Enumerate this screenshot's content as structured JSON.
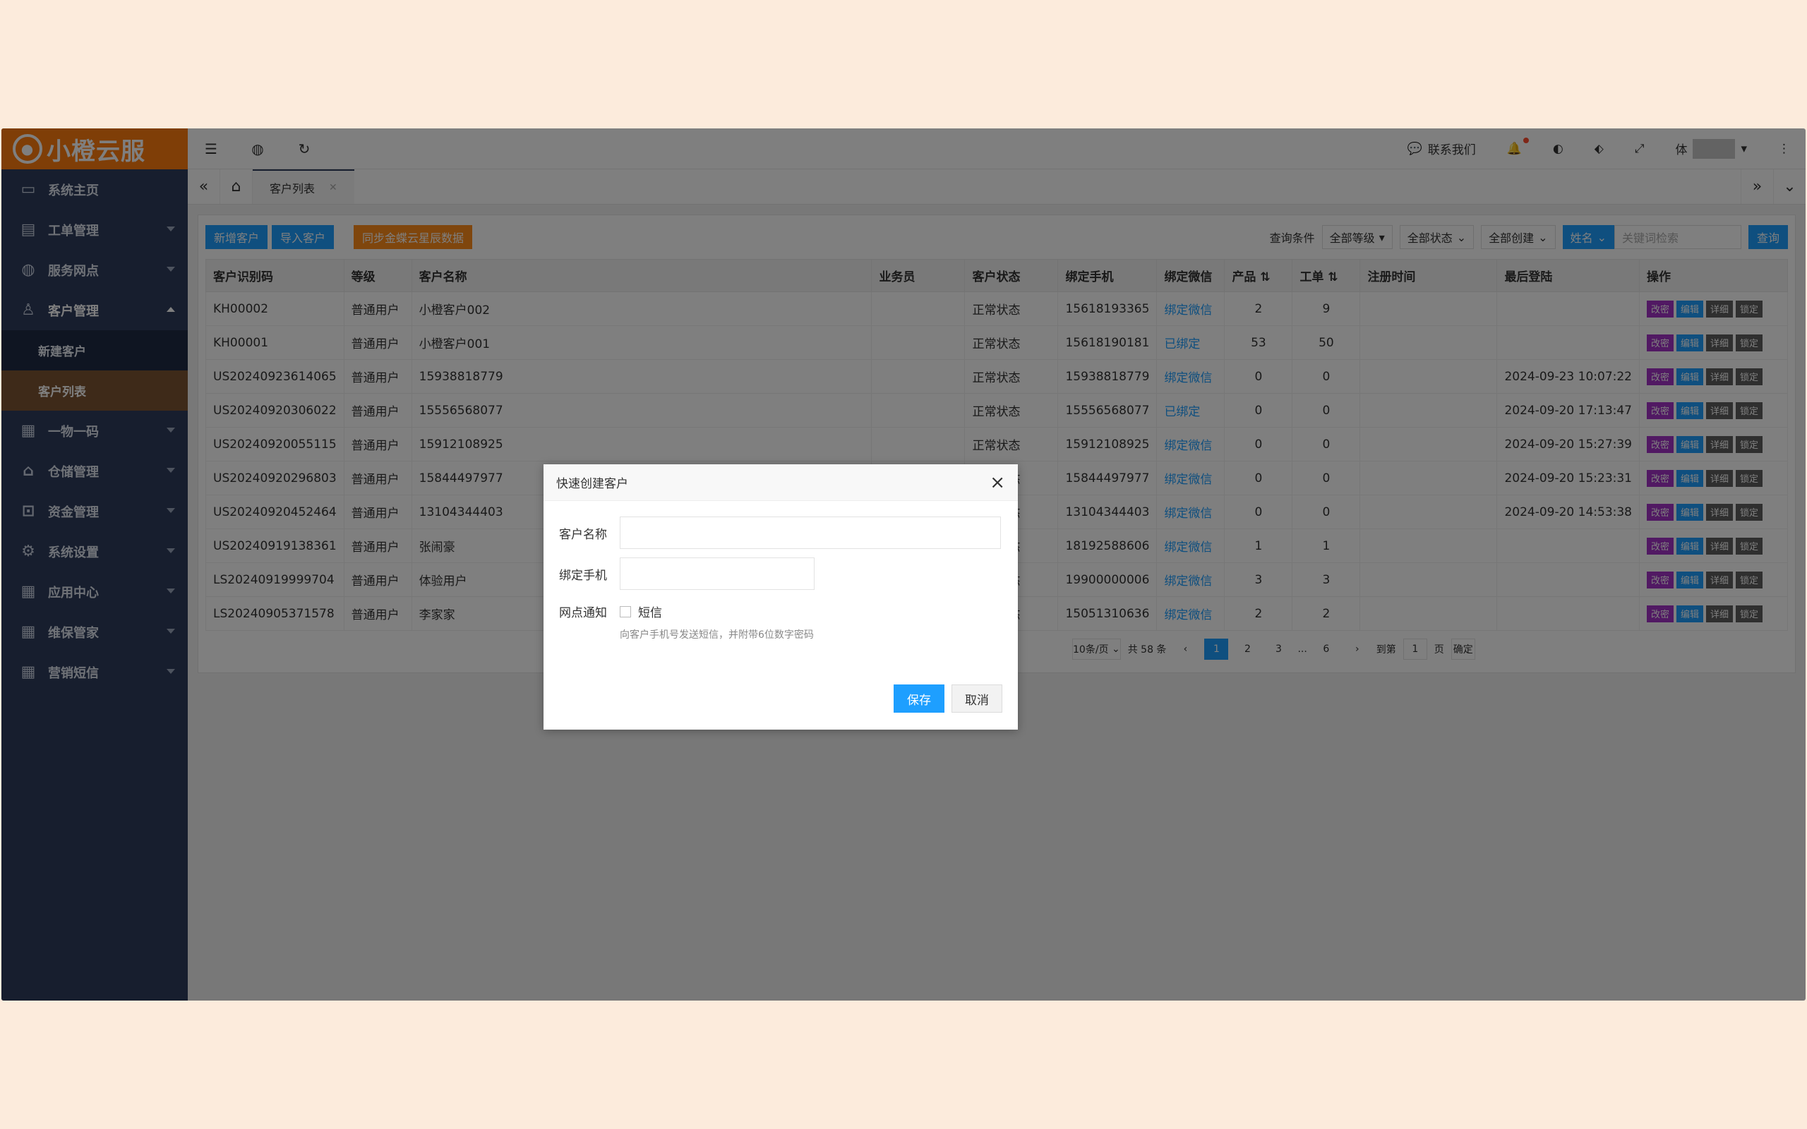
{
  "brand": {
    "logo_text": "小橙云服"
  },
  "sidebar": {
    "items": [
      {
        "label": "系统主页",
        "icon": "monitor-icon"
      },
      {
        "label": "工单管理",
        "icon": "document-icon"
      },
      {
        "label": "服务网点",
        "icon": "globe-icon"
      },
      {
        "label": "客户管理",
        "icon": "user-icon"
      },
      {
        "label": "一物一码",
        "icon": "grid-icon"
      },
      {
        "label": "仓储管理",
        "icon": "bank-icon"
      },
      {
        "label": "资金管理",
        "icon": "money-icon"
      },
      {
        "label": "系统设置",
        "icon": "gear-icon"
      },
      {
        "label": "应用中心",
        "icon": "grid-icon"
      },
      {
        "label": "维保管家",
        "icon": "grid-icon"
      },
      {
        "label": "营销短信",
        "icon": "grid-icon"
      }
    ],
    "sub_items": [
      "新建客户",
      "客户列表"
    ]
  },
  "topbar": {
    "contact_label": "联系我们",
    "user_label": "体"
  },
  "tabs": {
    "active_tab": "客户列表"
  },
  "toolbar": {
    "new_customer": "新增客户",
    "import_customer": "导入客户",
    "sync": "同步金蝶云星辰数据",
    "query_label": "查询条件",
    "filter_level": "全部等级",
    "filter_status": "全部状态",
    "filter_created": "全部创建",
    "filter_field": "姓名",
    "keyword_placeholder": "关键词检索",
    "search": "查询"
  },
  "table": {
    "headers": [
      "客户识别码",
      "等级",
      "客户名称",
      "业务员",
      "客户状态",
      "绑定手机",
      "绑定微信",
      "产品 ⇅",
      "工单 ⇅",
      "注册时间",
      "最后登陆",
      "操作"
    ],
    "ops": [
      "改密",
      "编辑",
      "详细",
      "锁定"
    ],
    "rows": [
      [
        "KH00002",
        "普通用户",
        "小橙客户002",
        "",
        "正常状态",
        "15618193365",
        "绑定微信",
        "2",
        "9",
        "",
        ""
      ],
      [
        "KH00001",
        "普通用户",
        "小橙客户001",
        "",
        "正常状态",
        "15618190181",
        "已绑定",
        "53",
        "50",
        "",
        ""
      ],
      [
        "US20240923614065",
        "普通用户",
        "15938818779",
        "",
        "正常状态",
        "15938818779",
        "绑定微信",
        "0",
        "0",
        "",
        "2024-09-23 10:07:22"
      ],
      [
        "US20240920306022",
        "普通用户",
        "15556568077",
        "",
        "正常状态",
        "15556568077",
        "已绑定",
        "0",
        "0",
        "",
        "2024-09-20 17:13:47"
      ],
      [
        "US20240920055115",
        "普通用户",
        "15912108925",
        "",
        "正常状态",
        "15912108925",
        "绑定微信",
        "0",
        "0",
        "",
        "2024-09-20 15:27:39"
      ],
      [
        "US20240920296803",
        "普通用户",
        "15844497977",
        "",
        "正常状态",
        "15844497977",
        "绑定微信",
        "0",
        "0",
        "",
        "2024-09-20 15:23:31"
      ],
      [
        "US20240920452464",
        "普通用户",
        "13104344403",
        "",
        "正常状态",
        "13104344403",
        "绑定微信",
        "0",
        "0",
        "",
        "2024-09-20 14:53:38"
      ],
      [
        "US20240919138361",
        "普通用户",
        "张闹豪",
        "",
        "正常状态",
        "18192588606",
        "绑定微信",
        "1",
        "1",
        "",
        ""
      ],
      [
        "LS20240919999704",
        "普通用户",
        "体验用户",
        "",
        "正常状态",
        "19900000006",
        "绑定微信",
        "3",
        "3",
        "",
        ""
      ],
      [
        "LS20240905371578",
        "普通用户",
        "李家家",
        "",
        "正常状态",
        "15051310636",
        "绑定微信",
        "2",
        "2",
        "",
        ""
      ]
    ]
  },
  "pager": {
    "page_size": "10条/页",
    "total": "共 58 条",
    "pages": [
      "1",
      "2",
      "3",
      "...",
      "6"
    ],
    "goto_label": "到第",
    "goto_value": "1",
    "page_unit": "页",
    "confirm": "确定"
  },
  "modal": {
    "title": "快速创建客户",
    "name_label": "客户名称",
    "phone_label": "绑定手机",
    "notify_label": "网点通知",
    "sms_label": "短信",
    "hint": "向客户手机号发送短信，并附带6位数字密码",
    "save": "保存",
    "cancel": "取消"
  },
  "colors": {
    "accent": "#1e9fff",
    "brand_orange": "#ff7d0e",
    "sidebar": "#2e3c5d"
  }
}
